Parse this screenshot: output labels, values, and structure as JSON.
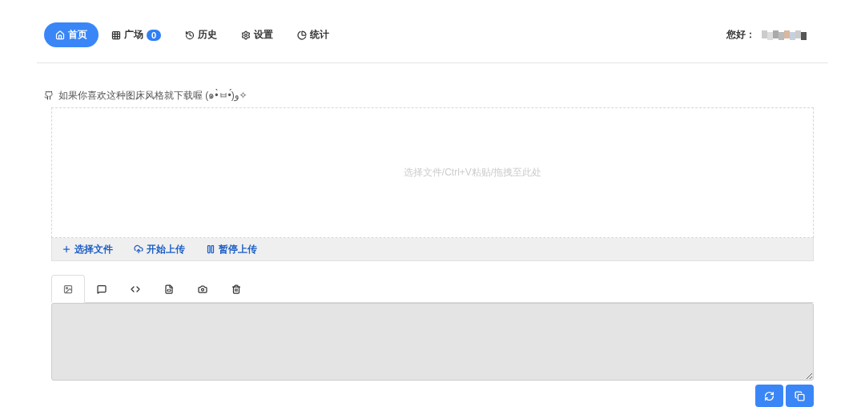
{
  "nav": {
    "items": [
      {
        "label": "首页",
        "selected": true
      },
      {
        "label": "广场",
        "selected": false,
        "badge": "0"
      },
      {
        "label": "历史",
        "selected": false
      },
      {
        "label": "设置",
        "selected": false
      },
      {
        "label": "统计",
        "selected": false
      }
    ],
    "greeting": "您好："
  },
  "notice": "如果你喜欢这种图床风格就下载喔 (๑•̀ㅂ•́)و✧",
  "upload": {
    "hint": "选择文件/Ctrl+V粘贴/拖拽至此处",
    "actions": [
      {
        "label": "选择文件"
      },
      {
        "label": "开始上传"
      },
      {
        "label": "暂停上传"
      }
    ]
  },
  "output_tabs": [
    {
      "selected": true
    },
    {
      "selected": false
    },
    {
      "selected": false
    },
    {
      "selected": false
    },
    {
      "selected": false
    },
    {
      "selected": false
    }
  ]
}
